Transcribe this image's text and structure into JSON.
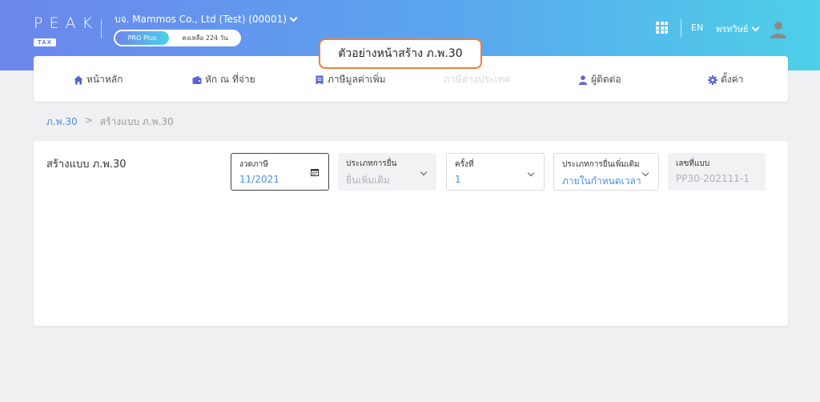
{
  "header": {
    "logo": "PEAK",
    "logo_sub": "TAX",
    "company": "บจ. Mammos Co., Ltd (Test) (00001)",
    "plan": "PRO Plus",
    "remaining": "คงเหลือ 224 วัน",
    "lang": "EN",
    "user": "พรทวิษย์"
  },
  "callout": "ตัวอย่างหน้าสร้าง ภ.พ.30",
  "nav": {
    "home": "หน้าหลัก",
    "withholding": "หัก ณ ที่จ่าย",
    "vat": "ภาษีมูลค่าเพิ่ม",
    "foreign": "ภาษีต่างประเทศ",
    "contacts": "ผู้ติดต่อ",
    "settings": "ตั้งค่า"
  },
  "breadcrumb": {
    "parent": "ภ.พ.30",
    "separator": ">",
    "current": "สร้างแบบ ภ.พ.30"
  },
  "form": {
    "title": "สร้างแบบ ภ.พ.30",
    "tax_period": {
      "label": "งวดภาษี",
      "value": "11/2021"
    },
    "filing_type": {
      "label": "ประเภทการยื่น",
      "value": "ยื่นเพิ่มเติม"
    },
    "times": {
      "label": "ครั้งที่",
      "value": "1"
    },
    "additional_type": {
      "label": "ประเภทการยื่นเพิ่มเติม",
      "value": "ภายในกำหนดเวลา"
    },
    "form_number": {
      "label": "เลขที่แบบ",
      "value": "PP30-202111-1"
    }
  },
  "colors": {
    "header_start": "#6c86ec",
    "header_end": "#4dd0e8",
    "callout_border": "#ee7f3b",
    "link": "#4b8fe3",
    "icon": "#5b63d6"
  }
}
